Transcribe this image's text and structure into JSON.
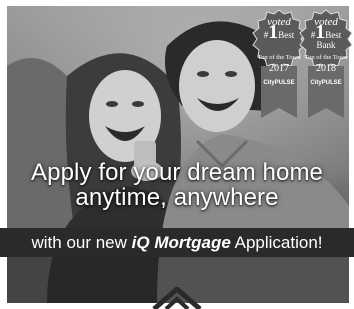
{
  "headline": {
    "line1": "Apply for your dream home",
    "line2": "anytime, anywhere"
  },
  "band": {
    "prefix": "with our new ",
    "product": "iQ Mortgage",
    "suffix": " Application!"
  },
  "badges": [
    {
      "voted": "voted",
      "hash": "#",
      "number": "1",
      "word": "Best",
      "word2": "Bank",
      "top": "Top of the Town",
      "year": "2017",
      "publisher": "CityPULSE"
    },
    {
      "voted": "voted",
      "hash": "#",
      "number": "1",
      "word": "Best",
      "word2": "Bank",
      "top": "Top of the Town",
      "year": "2018",
      "publisher": "CityPULSE"
    }
  ],
  "icons": {
    "logo": "house-logo-icon"
  },
  "colors": {
    "background": "#ffffff",
    "band": "#2a2a2a",
    "text": "#ffffff",
    "badge": "#5a5a5a"
  }
}
